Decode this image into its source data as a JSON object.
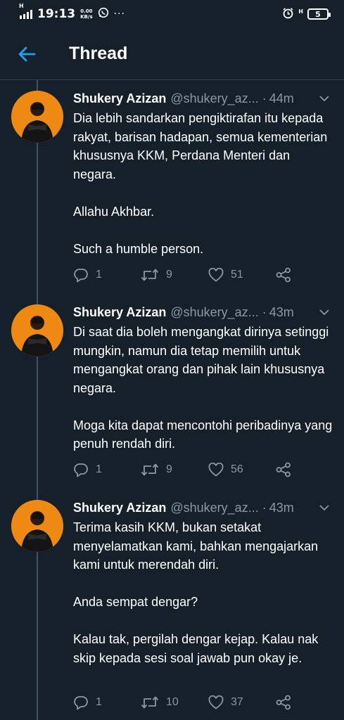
{
  "status_bar": {
    "network": "H",
    "time": "19:13",
    "speed_value": "0.00",
    "speed_unit": "KB/s",
    "more": "···",
    "network_right": "H",
    "battery": "5"
  },
  "header": {
    "title": "Thread"
  },
  "tweets": [
    {
      "name": "Shukery Azizan",
      "handle": "@shukery_az...",
      "separator": "·",
      "time": "44m",
      "paragraphs": [
        "Dia lebih sandarkan pengiktirafan itu kepada rakyat, barisan hadapan, semua kementerian khususnya KKM, Perdana Menteri dan negara.",
        "Allahu Akhbar.",
        "Such a humble person."
      ],
      "replies": "1",
      "retweets": "9",
      "likes": "51"
    },
    {
      "name": "Shukery Azizan",
      "handle": "@shukery_az...",
      "separator": "·",
      "time": "43m",
      "paragraphs": [
        "Di saat dia boleh mengangkat dirinya setinggi mungkin, namun dia tetap memilih untuk mengangkat orang dan pihak lain khususnya negara.",
        "Moga kita dapat mencontohi peribadinya yang penuh rendah diri."
      ],
      "replies": "1",
      "retweets": "9",
      "likes": "56"
    },
    {
      "name": "Shukery Azizan",
      "handle": "@shukery_az...",
      "separator": "·",
      "time": "43m",
      "paragraphs": [
        "Terima kasih KKM, bukan setakat menyelamatkan kami, bahkan mengajarkan kami untuk merendah diri.",
        "Anda sempat dengar?",
        "Kalau tak, pergilah dengar kejap. Kalau nak skip kepada sesi soal jawab pun okay je."
      ],
      "replies": "1",
      "retweets": "10",
      "likes": "37"
    }
  ],
  "colors": {
    "background": "#15202b",
    "accent": "#1da1f2",
    "secondary_text": "#8899a6",
    "avatar_bg": "#ee8a14"
  }
}
